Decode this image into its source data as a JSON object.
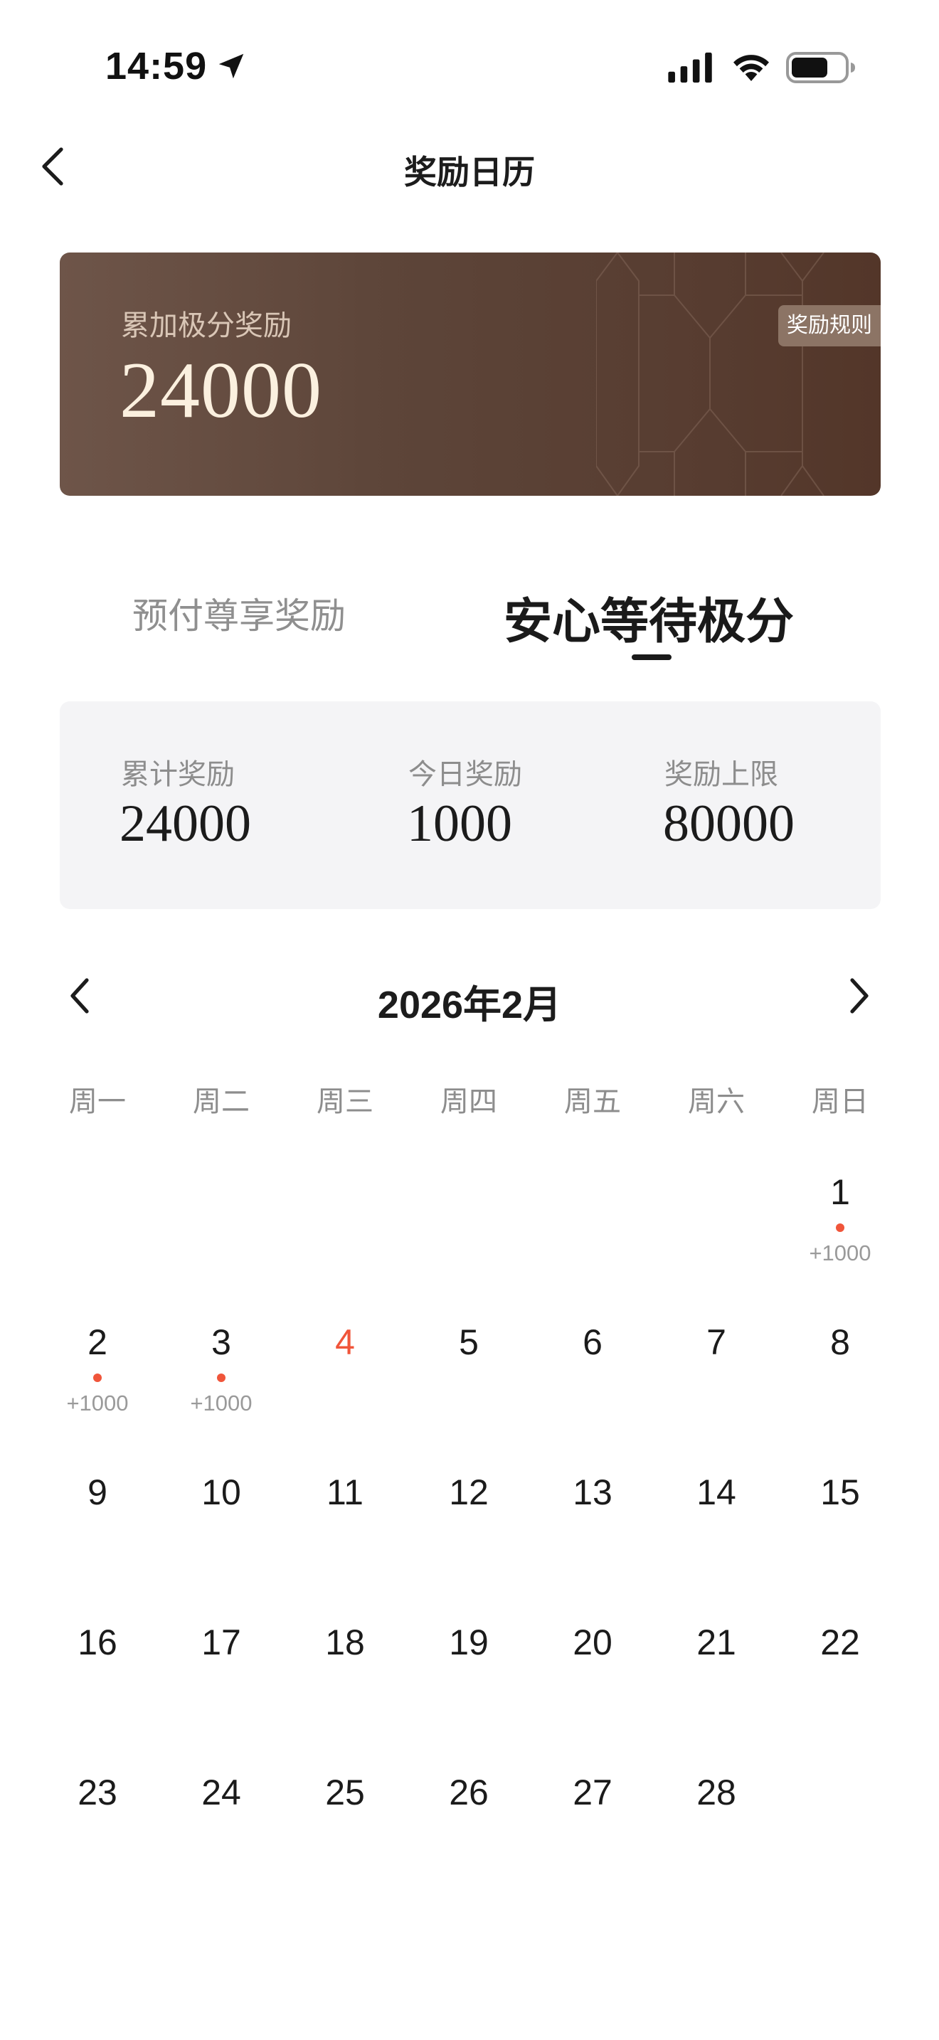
{
  "status_bar": {
    "time": "14:59"
  },
  "nav": {
    "title": "奖励日历"
  },
  "banner": {
    "label": "累加极分奖励",
    "value": "24000",
    "rules_button": "奖励规则"
  },
  "tabs": [
    {
      "label": "预付尊享奖励",
      "active": false
    },
    {
      "label": "安心等待极分",
      "active": true
    }
  ],
  "stats": [
    {
      "label": "累计奖励",
      "value": "24000"
    },
    {
      "label": "今日奖励",
      "value": "1000"
    },
    {
      "label": "奖励上限",
      "value": "80000"
    }
  ],
  "calendar": {
    "month_title": "2026年2月",
    "weekdays": [
      "周一",
      "周二",
      "周三",
      "周四",
      "周五",
      "周六",
      "周日"
    ],
    "today": 4,
    "days": [
      {
        "day": "1",
        "reward": "+1000"
      },
      {
        "day": "2",
        "reward": "+1000"
      },
      {
        "day": "3",
        "reward": "+1000"
      },
      {
        "day": "4"
      },
      {
        "day": "5"
      },
      {
        "day": "6"
      },
      {
        "day": "7"
      },
      {
        "day": "8"
      },
      {
        "day": "9"
      },
      {
        "day": "10"
      },
      {
        "day": "11"
      },
      {
        "day": "12"
      },
      {
        "day": "13"
      },
      {
        "day": "14"
      },
      {
        "day": "15"
      },
      {
        "day": "16"
      },
      {
        "day": "17"
      },
      {
        "day": "18"
      },
      {
        "day": "19"
      },
      {
        "day": "20"
      },
      {
        "day": "21"
      },
      {
        "day": "22"
      },
      {
        "day": "23"
      },
      {
        "day": "24"
      },
      {
        "day": "25"
      },
      {
        "day": "26"
      },
      {
        "day": "27"
      },
      {
        "day": "28"
      }
    ]
  },
  "colors": {
    "accent": "#f0553a",
    "banner": "#5d4539",
    "stats_bg": "#f4f4f6"
  },
  "icons": [
    "location-arrow-icon",
    "signal-icon",
    "wifi-icon",
    "battery-icon",
    "back-chevron-icon",
    "prev-month-icon",
    "next-month-icon"
  ]
}
